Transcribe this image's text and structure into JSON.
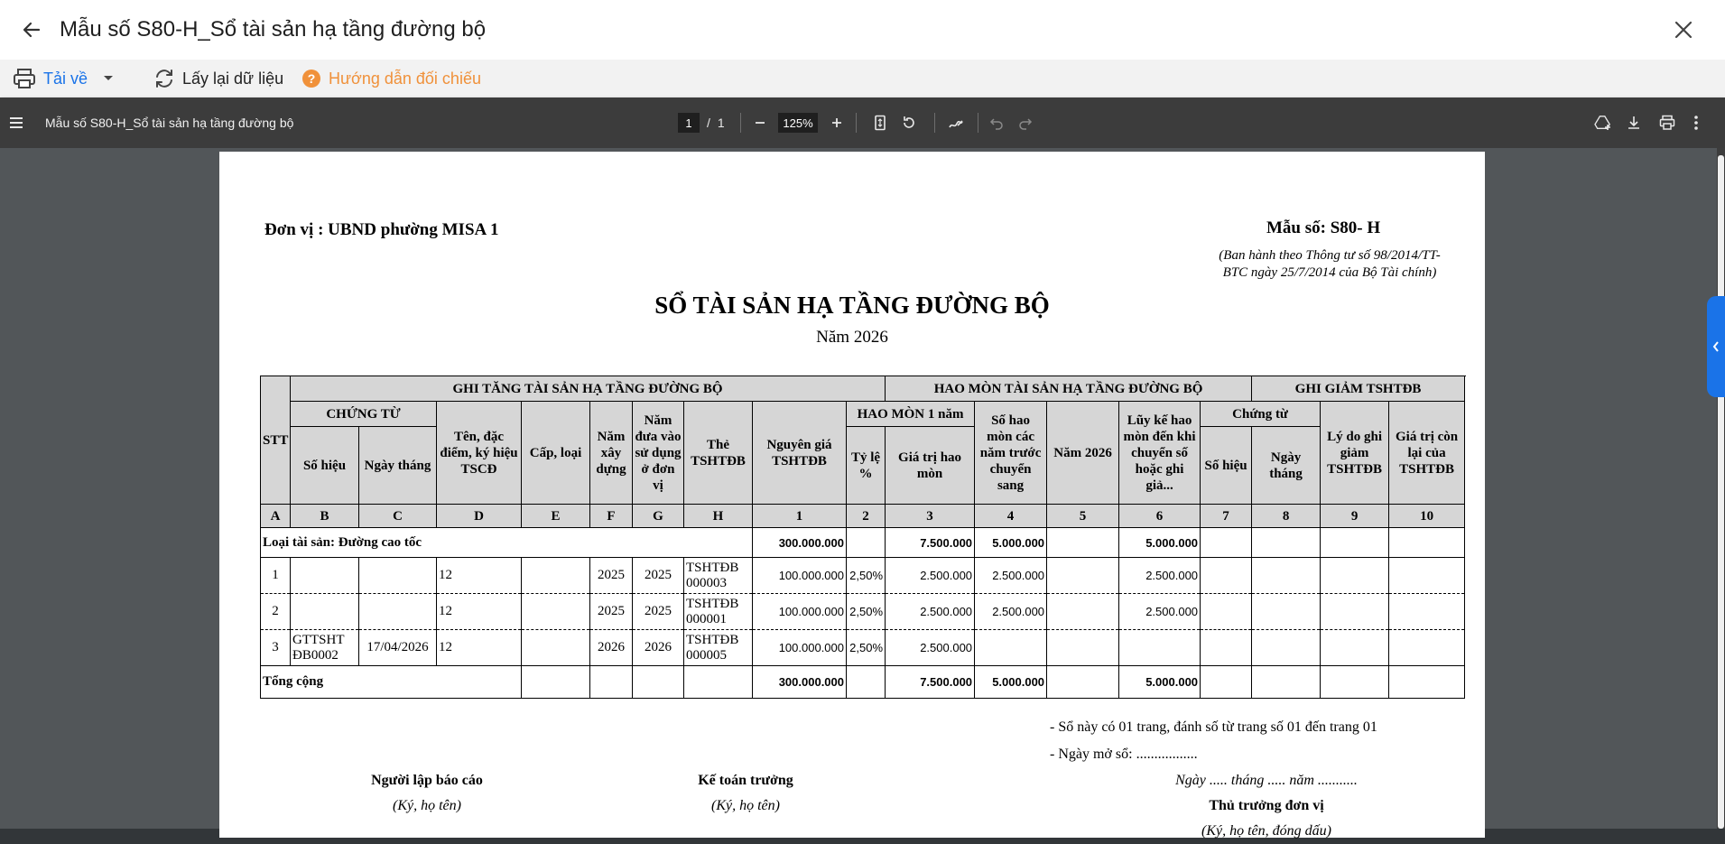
{
  "window": {
    "title": "Mẫu số S80-H_Sổ tài sản hạ tầng đường bộ"
  },
  "actions": {
    "download_label": "Tải về",
    "reload_label": "Lấy lại dữ liệu",
    "guide_label": "Hướng dẫn đối chiếu",
    "accent": "#1a73e8",
    "guide_color": "#f0913a"
  },
  "viewer": {
    "doc_title": "Mẫu số S80-H_Sổ tài sản hạ tầng đường bộ",
    "page_current": "1",
    "page_sep": "/",
    "page_total": "1",
    "zoom": "125%"
  },
  "document": {
    "unit": "Đơn vị : UBND phường MISA 1",
    "form_no": "Mẫu số: S80- H",
    "issued_by_1": "(Ban hành theo Thông tư số 98/2014/TT-",
    "issued_by_2": "BTC ngày 25/7/2014 của Bộ Tài chính)",
    "title": "SỔ TÀI SẢN HẠ TẦNG ĐƯỜNG BỘ",
    "year": "Năm 2026",
    "headers": {
      "stt": "STT",
      "increase": "GHI TĂNG TÀI SẢN HẠ TẦNG ĐƯỜNG BỘ",
      "depreciation": "HAO MÒN TÀI SẢN HẠ TẦNG ĐƯỜNG BỘ",
      "decrease": "GHI GIẢM TSHTĐB",
      "voucher": "CHỨNG TỪ",
      "voucher_no": "Số hiệu",
      "voucher_date": "Ngày tháng",
      "name": "Tên, đặc điểm, ký hiệu TSCĐ",
      "grade": "Cấp, loại",
      "build_year": "Năm xây dựng",
      "use_year": "Năm đưa vào sử dụng ở đơn vị",
      "card": "Thẻ TSHTĐB",
      "cost": "Nguyên giá TSHTĐB",
      "dep_1yr": "HAO MÒN 1 năm",
      "rate": "Tỷ lệ %",
      "dep_value": "Giá trị hao mòn",
      "dep_prior": "Số hao mòn các năm trước chuyển sang",
      "dep_year": "Năm 2026",
      "accum": "Lũy kế hao mòn đến khi chuyển số hoặc ghi giả...",
      "dec_voucher": "Chứng từ",
      "dec_no": "Số hiệu",
      "dec_date": "Ngày tháng",
      "reason": "Lý do ghi giảm TSHTĐB",
      "remaining": "Giá trị còn lại của TSHTĐB",
      "codes": [
        "A",
        "B",
        "C",
        "D",
        "E",
        "F",
        "G",
        "H",
        "1",
        "2",
        "3",
        "4",
        "5",
        "6",
        "7",
        "8",
        "9",
        "10"
      ]
    },
    "group": {
      "label": "Loại tài sản: Đường cao tốc",
      "cost": "300.000.000",
      "dep_value": "7.500.000",
      "dep_prior": "5.000.000",
      "accum": "5.000.000"
    },
    "rows": [
      {
        "stt": "1",
        "voucher_no": "",
        "voucher_date": "",
        "name": "12",
        "grade": "",
        "build": "2025",
        "use": "2025",
        "card": "TSHTĐB 000003",
        "cost": "100.000.000",
        "rate": "2,50%",
        "dep_value": "2.500.000",
        "dep_prior": "2.500.000",
        "dep_year": "",
        "accum": "2.500.000"
      },
      {
        "stt": "2",
        "voucher_no": "",
        "voucher_date": "",
        "name": "12",
        "grade": "",
        "build": "2025",
        "use": "2025",
        "card": "TSHTĐB 000001",
        "cost": "100.000.000",
        "rate": "2,50%",
        "dep_value": "2.500.000",
        "dep_prior": "2.500.000",
        "dep_year": "",
        "accum": "2.500.000"
      },
      {
        "stt": "3",
        "voucher_no": "GTTSHT ĐB0002",
        "voucher_date": "17/04/2026",
        "name": "12",
        "grade": "",
        "build": "2026",
        "use": "2026",
        "card": "TSHTĐB 000005",
        "cost": "100.000.000",
        "rate": "2,50%",
        "dep_value": "2.500.000",
        "dep_prior": "",
        "dep_year": "",
        "accum": ""
      }
    ],
    "total": {
      "label": "Tổng cộng",
      "cost": "300.000.000",
      "dep_value": "7.500.000",
      "dep_prior": "5.000.000",
      "accum": "5.000.000"
    },
    "notes": {
      "pages": "- Sổ này có 01 trang, đánh số từ trang số 01 đến trang 01",
      "open_date": "- Ngày mở sổ:        .................",
      "date_line": "Ngày ..... tháng ..... năm ..........."
    },
    "signatures": {
      "preparer": "Người lập báo cáo",
      "preparer_note": "(Ký, họ tên)",
      "accountant": "Kế toán trưởng",
      "accountant_note": "(Ký, họ tên)",
      "head": "Thủ trưởng đơn vị",
      "head_note": "(Ký, họ tên, đóng dấu)"
    }
  }
}
